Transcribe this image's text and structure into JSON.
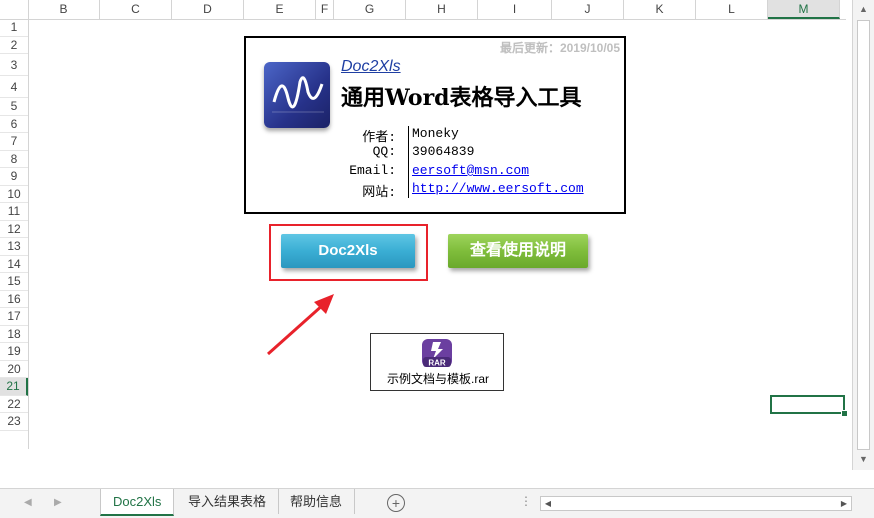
{
  "columns": [
    {
      "label": "B",
      "selected": false
    },
    {
      "label": "C",
      "selected": false
    },
    {
      "label": "D",
      "selected": false
    },
    {
      "label": "E",
      "selected": false
    },
    {
      "label": "F",
      "selected": false
    },
    {
      "label": "G",
      "selected": false
    },
    {
      "label": "H",
      "selected": false
    },
    {
      "label": "I",
      "selected": false
    },
    {
      "label": "J",
      "selected": false
    },
    {
      "label": "K",
      "selected": false
    },
    {
      "label": "L",
      "selected": false
    },
    {
      "label": "M",
      "selected": true
    }
  ],
  "rows": [
    "1",
    "2",
    "3",
    "4",
    "5",
    "6",
    "7",
    "8",
    "9",
    "10",
    "11",
    "12",
    "13",
    "14",
    "15",
    "16",
    "17",
    "18",
    "19",
    "20",
    "21",
    "22",
    "23"
  ],
  "selected_row": "21",
  "card": {
    "updated": "最后更新：2019/10/05",
    "app_link": "Doc2Xls",
    "title": "通用Word表格导入工具",
    "info": [
      {
        "label": "作者:",
        "value": "Moneky",
        "link": false
      },
      {
        "label": "QQ:",
        "value": "39064839",
        "link": false
      },
      {
        "label": "Email:",
        "value": "eersoft@msn.com",
        "link": true
      },
      {
        "label": "网站:",
        "value": "http://www.eersoft.com",
        "link": true
      }
    ]
  },
  "buttons": {
    "doc2xls": "Doc2Xls",
    "help": "查看使用说明"
  },
  "highlight_color": "#e8222b",
  "embedded_file": {
    "icon": "rar-archive-icon",
    "icon_text": "RAR",
    "label": "示例文档与模板.rar"
  },
  "sheets": [
    {
      "label": "Doc2Xls",
      "active": true
    },
    {
      "label": "导入结果表格",
      "active": false
    },
    {
      "label": "帮助信息",
      "active": false
    }
  ],
  "accent_color": "#217346"
}
